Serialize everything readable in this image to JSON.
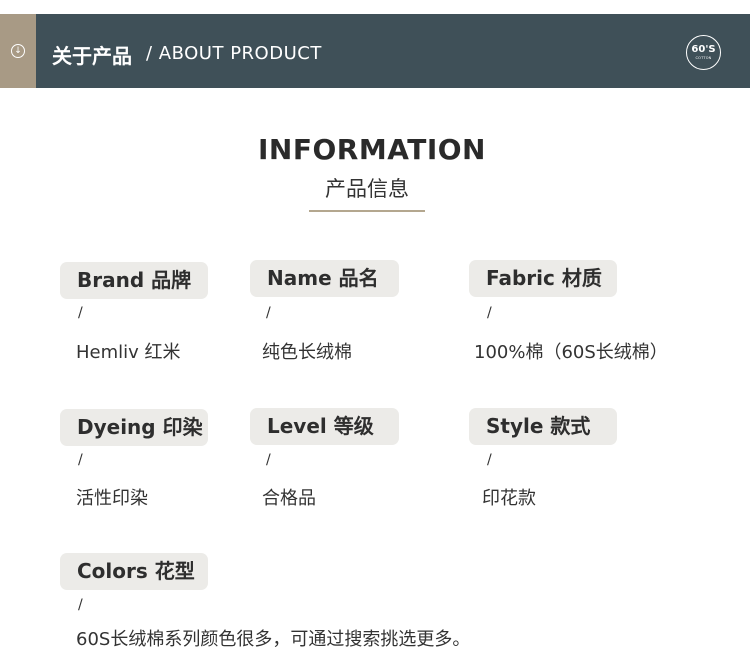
{
  "header": {
    "title": "关于产品",
    "subtitle": "/ ABOUT PRODUCT",
    "badge_top": "60'S",
    "badge_bottom": "COTTON",
    "bg_color": "#3f5058",
    "accent_color": "#a89a85",
    "accent_icon": "down-arrow-circle-icon"
  },
  "section": {
    "title": "INFORMATION",
    "subtitle": "产品信息",
    "line_color": "#b4a78f"
  },
  "specs": {
    "brand": {
      "label": "Brand 品牌",
      "separator": "/",
      "value": "Hemliv 红米"
    },
    "name": {
      "label": "Name 品名",
      "separator": "/",
      "value": "纯色长绒棉"
    },
    "fabric": {
      "label": "Fabric 材质",
      "separator": "/",
      "value": "100%棉（60S长绒棉）"
    },
    "dyeing": {
      "label": "Dyeing 印染",
      "separator": "/",
      "value": "活性印染"
    },
    "level": {
      "label": "Level 等级",
      "separator": "/",
      "value": "合格品"
    },
    "style": {
      "label": "Style 款式",
      "separator": "/",
      "value": "印花款"
    },
    "colors": {
      "label": "Colors 花型",
      "separator": "/",
      "value": "60S长绒棉系列颜色很多，可通过搜索挑选更多。"
    }
  }
}
